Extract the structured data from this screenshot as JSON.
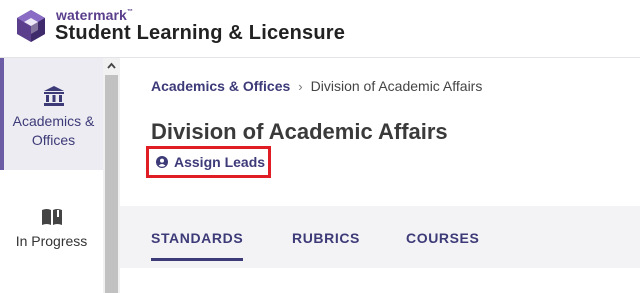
{
  "header": {
    "brand_small": "watermark",
    "brand_tm": "™",
    "brand_title": "Student Learning & Licensure",
    "logo_icon": "watermark-logo-icon"
  },
  "sidebar": {
    "items": [
      {
        "label_line1": "Academics &",
        "label_line2": "Offices",
        "icon": "institution-icon",
        "active": true
      },
      {
        "label": "In Progress",
        "icon": "open-book-icon",
        "active": false
      }
    ]
  },
  "breadcrumb": {
    "parent": "Academics & Offices",
    "separator": "›",
    "current": "Division of Academic Affairs"
  },
  "page": {
    "title": "Division of Academic Affairs",
    "assign_leads": "Assign Leads",
    "assign_icon": "user-circle-icon"
  },
  "tabs": [
    {
      "label": "STANDARDS",
      "active": true
    },
    {
      "label": "RUBRICS",
      "active": false
    },
    {
      "label": "COURSES",
      "active": false
    }
  ],
  "colors": {
    "accent": "#3d3a78",
    "brand": "#5b3f8c",
    "highlight_border": "#e01c25"
  }
}
